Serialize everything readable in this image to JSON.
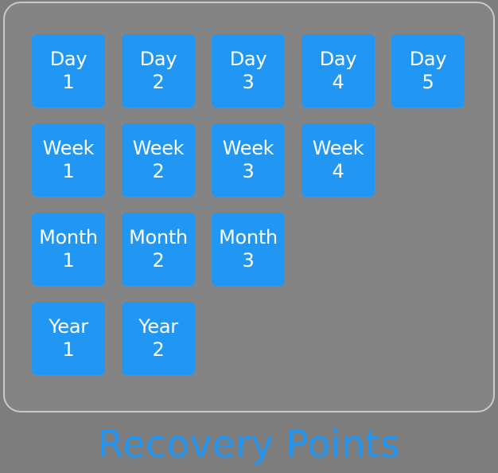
{
  "panel": {
    "background_color": "#848484",
    "border_color": "#c9c9c9"
  },
  "theme": {
    "tile_color": "#2196f3",
    "tile_text_color": "#ffffff",
    "canvas_color": "#7d7d7d",
    "caption_color": "#2196f3"
  },
  "caption": {
    "text": "Recovery Points"
  },
  "grid": {
    "rows": [
      {
        "unit": "Day",
        "tiles": [
          {
            "unit": "Day",
            "number": "1",
            "label": "Day 1"
          },
          {
            "unit": "Day",
            "number": "2",
            "label": "Day 2"
          },
          {
            "unit": "Day",
            "number": "3",
            "label": "Day 3"
          },
          {
            "unit": "Day",
            "number": "4",
            "label": "Day 4"
          },
          {
            "unit": "Day",
            "number": "5",
            "label": "Day 5"
          }
        ]
      },
      {
        "unit": "Week",
        "tiles": [
          {
            "unit": "Week",
            "number": "1",
            "label": "Week 1"
          },
          {
            "unit": "Week",
            "number": "2",
            "label": "Week 2"
          },
          {
            "unit": "Week",
            "number": "3",
            "label": "Week 3"
          },
          {
            "unit": "Week",
            "number": "4",
            "label": "Week 4"
          }
        ]
      },
      {
        "unit": "Month",
        "tiles": [
          {
            "unit": "Month",
            "number": "1",
            "label": "Month 1"
          },
          {
            "unit": "Month",
            "number": "2",
            "label": "Month 2"
          },
          {
            "unit": "Month",
            "number": "3",
            "label": "Month 3"
          }
        ]
      },
      {
        "unit": "Year",
        "tiles": [
          {
            "unit": "Year",
            "number": "1",
            "label": "Year 1"
          },
          {
            "unit": "Year",
            "number": "2",
            "label": "Year 2"
          }
        ]
      }
    ]
  }
}
